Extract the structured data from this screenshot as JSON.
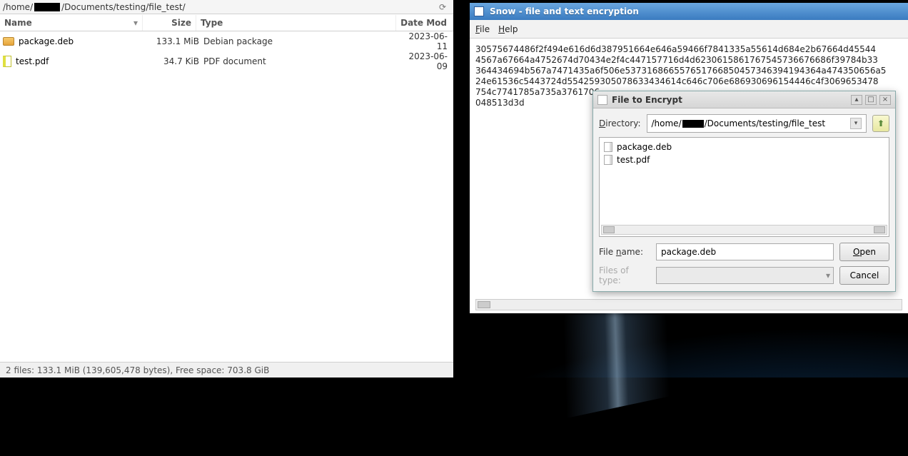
{
  "file_manager": {
    "path_prefix": "/home/",
    "path_suffix": "/Documents/testing/file_test/",
    "columns": {
      "name": "Name",
      "size": "Size",
      "type": "Type",
      "date": "Date Mod"
    },
    "rows": [
      {
        "name": "package.deb",
        "size": "133.1 MiB",
        "type": "Debian package",
        "date": "2023-06-11",
        "icon": "deb"
      },
      {
        "name": "test.pdf",
        "size": "34.7 KiB",
        "type": "PDF document",
        "date": "2023-06-09",
        "icon": "pdf"
      }
    ],
    "status": "2 files: 133.1 MiB (139,605,478 bytes), Free space: 703.8 GiB"
  },
  "snow_window": {
    "title": "Snow - file and text encryption",
    "menu": {
      "file": "File",
      "help": "Help"
    },
    "hex_lines": [
      "30575674486f2f494e616d6d387951664e646a59466f7841335a55614d684e2b67664d45544",
      "4567a67664a4752674d70434e2f4c447157716d4d6230615861767545736676686f39784b33",
      "364434694b567a7471435a6f506e537316866557651766850457346394194364a474350656a5",
      "24e61536c5443724d554259305078633434614c646c706e686930696154446c4f3069653478",
      "754c7741785a735a3761706",
      "048513d3d"
    ]
  },
  "dialog": {
    "title": "File to Encrypt",
    "dir_label": "Directory:",
    "dir_prefix": "/home/",
    "dir_suffix": "/Documents/testing/file_test",
    "items": [
      {
        "name": "package.deb"
      },
      {
        "name": "test.pdf"
      }
    ],
    "filename_label": "File name:",
    "filename_value": "package.deb",
    "filetype_label": "Files of type:",
    "open": "Open",
    "cancel": "Cancel",
    "win_min": "▴",
    "win_max": "□",
    "win_close": "×"
  }
}
